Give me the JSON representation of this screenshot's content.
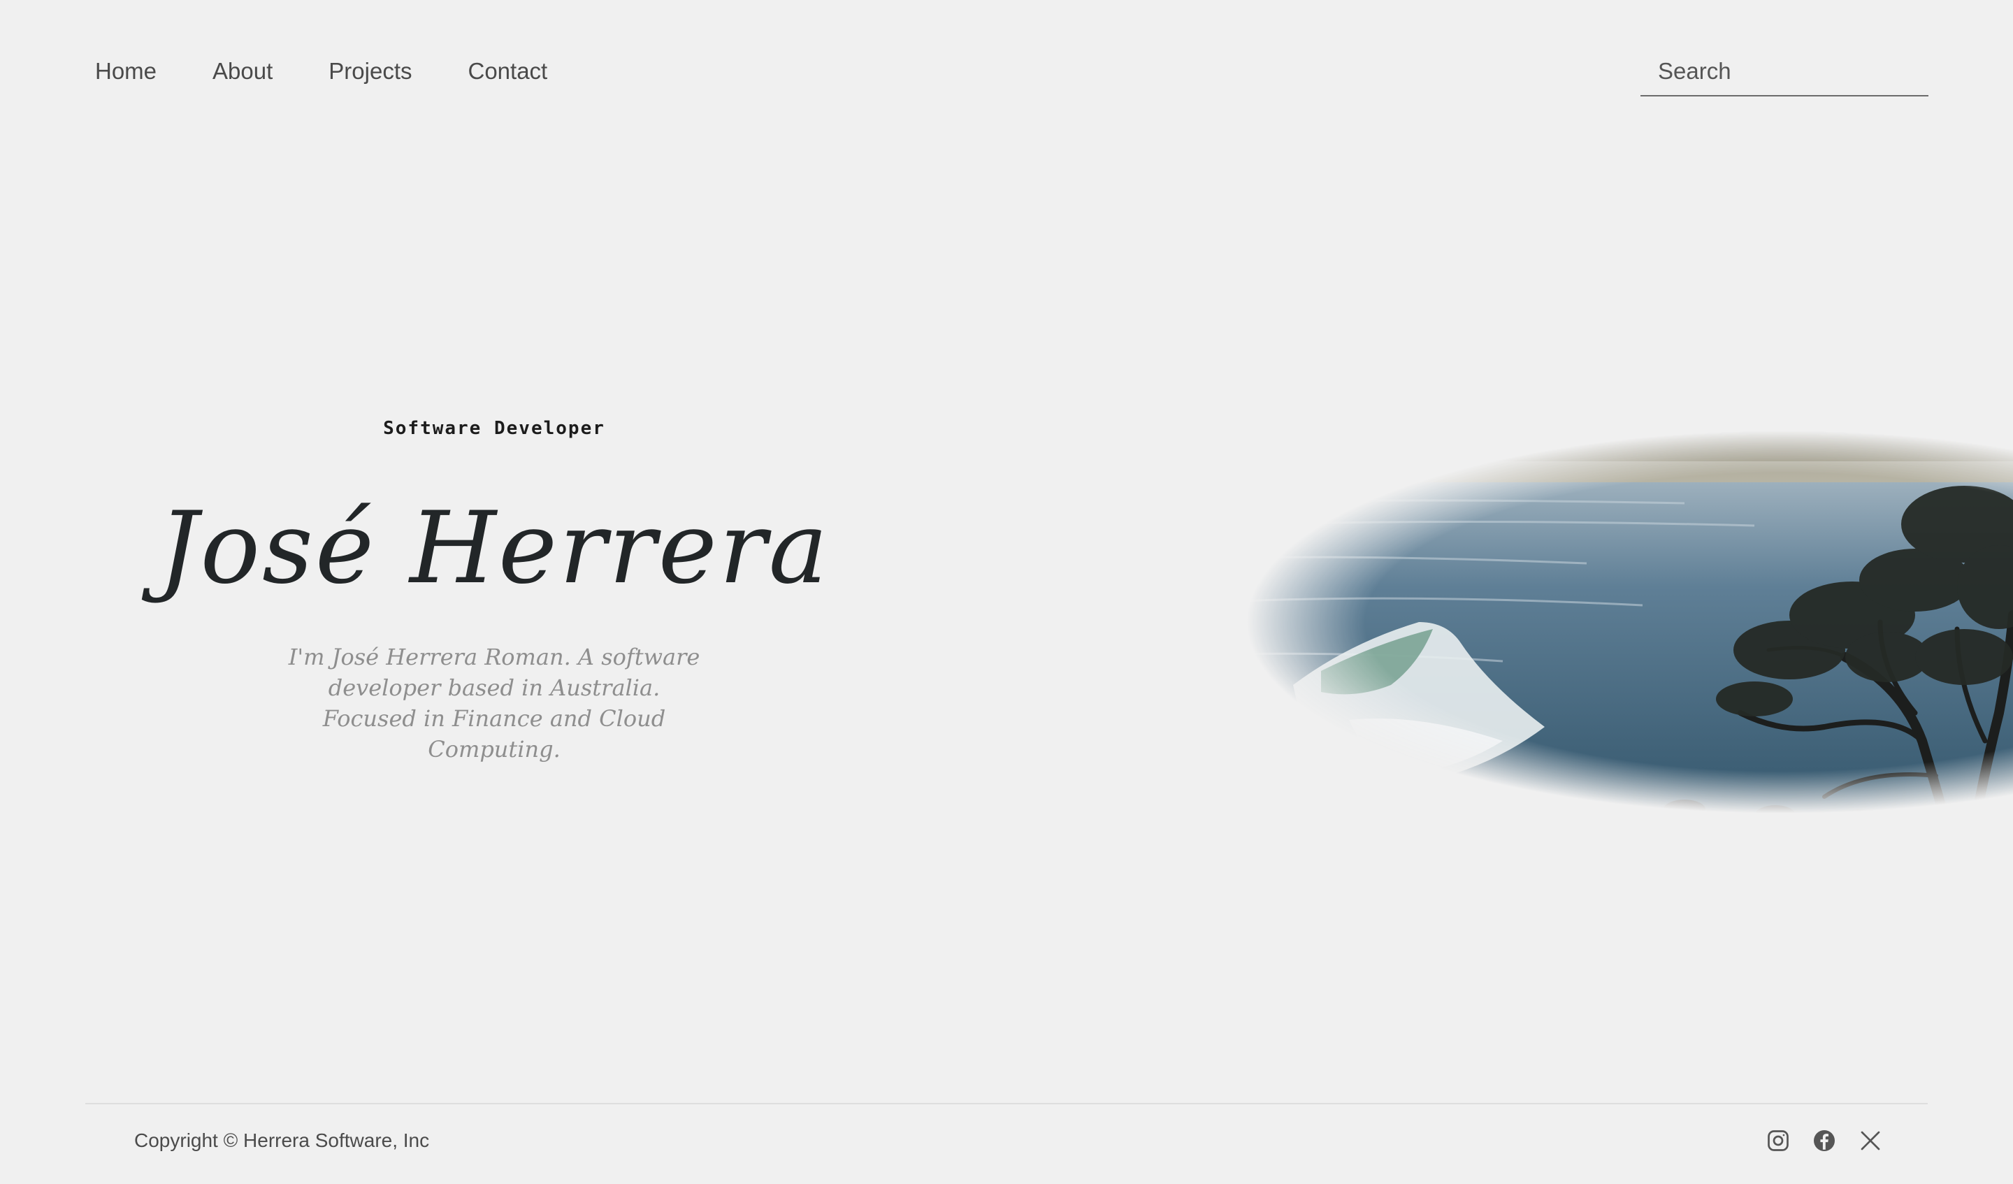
{
  "nav": {
    "items": [
      {
        "label": "Home"
      },
      {
        "label": "About"
      },
      {
        "label": "Projects"
      },
      {
        "label": "Contact"
      }
    ],
    "search_placeholder": "Search"
  },
  "hero": {
    "subtitle": "Software Developer",
    "name": "José Herrera",
    "bio": "I'm José Herrera Roman. A software developer based in Australia. Focused in Finance and Cloud Computing.",
    "image_icon": "coastal-landscape-photo"
  },
  "footer": {
    "copyright": "Copyright © Herrera Software, Inc",
    "social_icons": [
      "instagram-icon",
      "facebook-icon",
      "x-icon"
    ]
  },
  "colors": {
    "background": "#f0f0f0",
    "nav_text": "#4a4a4a",
    "name_text": "#222628",
    "bio_text": "#8e8e8e",
    "footer_text": "#4b4b4b",
    "icon": "#555555"
  }
}
